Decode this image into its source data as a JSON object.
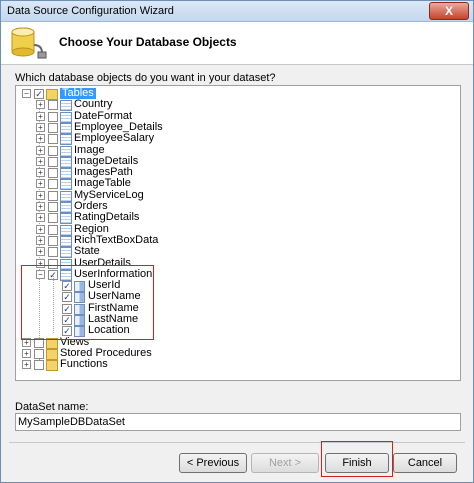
{
  "window": {
    "title": "Data Source Configuration Wizard",
    "close_label": "X"
  },
  "header": {
    "title": "Choose Your Database Objects"
  },
  "question": "Which database objects do you want in your dataset?",
  "tree": {
    "root": "Tables",
    "tables": [
      "Country",
      "DateFormat",
      "Employee_Details",
      "EmployeeSalary",
      "Image",
      "ImageDetails",
      "ImagesPath",
      "ImageTable",
      "MyServiceLog",
      "Orders",
      "RatingDetails",
      "Region",
      "RichTextBoxData",
      "State",
      "UserDetails"
    ],
    "expanded_table": {
      "name": "UserInformation",
      "columns": [
        "UserId",
        "UserName",
        "FirstName",
        "LastName",
        "Location"
      ]
    },
    "other_nodes": [
      "Views",
      "Stored Procedures",
      "Functions"
    ]
  },
  "dataset": {
    "label": "DataSet name:",
    "value": "MySampleDBDataSet"
  },
  "buttons": {
    "previous": "< Previous",
    "next": "Next >",
    "finish": "Finish",
    "cancel": "Cancel"
  }
}
